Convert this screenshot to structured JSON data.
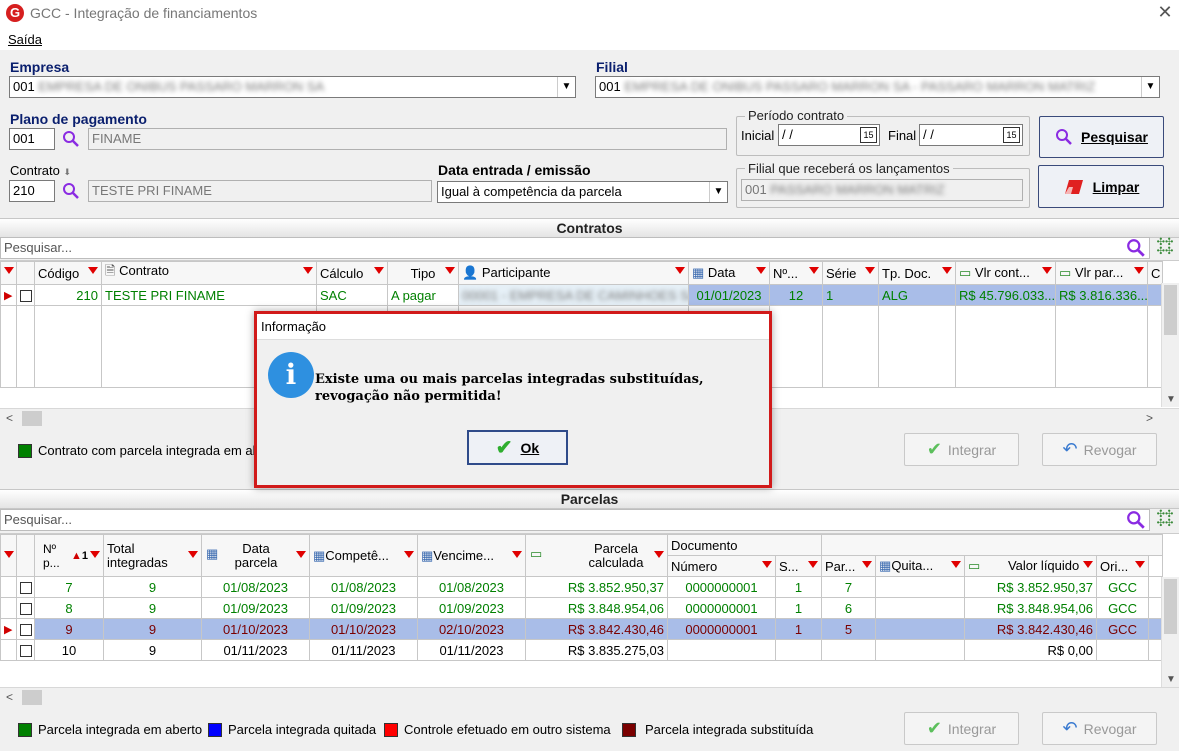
{
  "window": {
    "title": "GCC - Integração de financiamentos"
  },
  "menu": {
    "saida": "Saída"
  },
  "form": {
    "empresa_label": "Empresa",
    "empresa_code": "001",
    "empresa_name": "EMPRESA DE ONIBUS PASSARO MARRON SA",
    "filial_label": "Filial",
    "filial_code": "001",
    "filial_name": "EMPRESA DE ONIBUS PASSARO MARRON SA - PASSARO MARRON MATRIZ",
    "plano_label": "Plano de pagamento",
    "plano_code": "001",
    "plano_name": "FINAME",
    "contrato_label": "Contrato",
    "contrato_code": "210",
    "contrato_name": "TESTE PRI FINAME",
    "data_entrada_label": "Data entrada / emissão",
    "data_entrada_value": "Igual à competência da parcela",
    "periodo_label": "Período contrato",
    "inicial_label": "Inicial",
    "inicial_value": " / /",
    "final_label": "Final",
    "final_value": " / /",
    "cal_label": "15",
    "filial_receb_label": "Filial que receberá os lançamentos",
    "filial_receb_code": "001",
    "filial_receb_name": "PASSARO MARRON MATRIZ",
    "pesquisar_btn": "Pesquisar",
    "limpar_btn": "Limpar"
  },
  "contratos": {
    "section_title": "Contratos",
    "search_placeholder": "Pesquisar...",
    "headers": {
      "codigo": "Código",
      "contrato": "Contrato",
      "calculo": "Cálculo",
      "tipo": "Tipo",
      "participante": "Participante",
      "data": "Data",
      "num": "Nº...",
      "serie": "Série",
      "tpdoc": "Tp. Doc.",
      "vlrcont": "Vlr cont...",
      "vlrpar": "Vlr par...",
      "extra": "C"
    },
    "row": {
      "codigo": "210",
      "contrato": "TESTE PRI FINAME",
      "calculo": "SAC",
      "tipo": "A pagar",
      "participante": "00001 - EMPRESA DE CAMINHOES SA",
      "data": "01/01/2023",
      "num": "12",
      "serie": "1",
      "tpdoc": "ALG",
      "vlrcont": "R$ 45.796.033...",
      "vlrpar": "R$ 3.816.336..."
    },
    "legend": "Contrato com parcela integrada em aberto",
    "integrar_btn": "Integrar",
    "revogar_btn": "Revogar"
  },
  "parcelas": {
    "section_title": "Parcelas",
    "search_placeholder": "Pesquisar...",
    "headers": {
      "np": "Nº p...",
      "sort": "1",
      "total": "Total integradas",
      "data": "Data parcela",
      "compet": "Competê...",
      "venc": "Vencime...",
      "calc": "Parcela calculada",
      "documento": "Documento",
      "numero": "Número",
      "s": "S...",
      "par": "Par...",
      "quita": "Quita...",
      "valor": "Valor líquido",
      "ori": "Ori...",
      "n": "N"
    },
    "rows": [
      {
        "np": "7",
        "total": "9",
        "data": "01/08/2023",
        "compet": "01/08/2023",
        "venc": "01/08/2023",
        "calc": "R$ 3.852.950,37",
        "numero": "0000000001",
        "s": "1",
        "par": "7",
        "quita": "",
        "valor": "R$ 3.852.950,37",
        "ori": "GCC"
      },
      {
        "np": "8",
        "total": "9",
        "data": "01/09/2023",
        "compet": "01/09/2023",
        "venc": "01/09/2023",
        "calc": "R$ 3.848.954,06",
        "numero": "0000000001",
        "s": "1",
        "par": "6",
        "quita": "",
        "valor": "R$ 3.848.954,06",
        "ori": "GCC"
      },
      {
        "np": "9",
        "total": "9",
        "data": "01/10/2023",
        "compet": "01/10/2023",
        "venc": "02/10/2023",
        "calc": "R$ 3.842.430,46",
        "numero": "0000000001",
        "s": "1",
        "par": "5",
        "quita": "",
        "valor": "R$ 3.842.430,46",
        "ori": "GCC"
      },
      {
        "np": "10",
        "total": "9",
        "data": "01/11/2023",
        "compet": "01/11/2023",
        "venc": "01/11/2023",
        "calc": "R$ 3.835.275,03",
        "numero": "",
        "s": "",
        "par": "",
        "quita": "",
        "valor": "R$ 0,00",
        "ori": ""
      }
    ],
    "legend": [
      "Parcela integrada em aberto",
      "Parcela integrada quitada",
      "Controle efetuado em outro sistema",
      "Parcela integrada substituída"
    ],
    "integrar_btn": "Integrar",
    "revogar_btn": "Revogar"
  },
  "dialog": {
    "title": "Informação",
    "message": "Existe uma ou mais parcelas integradas substituídas, revogação não permitida!",
    "ok": "Ok",
    "icon": "i"
  },
  "colors": {
    "green": "#008000",
    "blue": "#0000ff",
    "red": "#ff0000",
    "darkred": "#7a0000",
    "selected": "#a9bde8",
    "dialog_border": "#d11a1a"
  }
}
